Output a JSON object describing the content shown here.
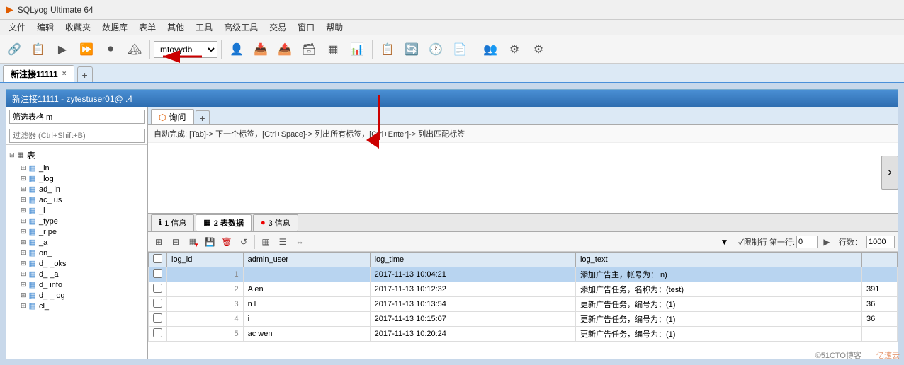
{
  "app": {
    "title": "SQLyog Ultimate 64",
    "icon": "▶"
  },
  "menu": {
    "items": [
      "文件",
      "编辑",
      "收藏夹",
      "数据库",
      "表单",
      "其他",
      "工具",
      "高级工具",
      "交易",
      "窗口",
      "帮助"
    ]
  },
  "toolbar": {
    "db_select": "mtoyydb",
    "db_options": [
      "mtoyydb"
    ]
  },
  "tabs": {
    "main_tab": "新注接11111",
    "close": "×",
    "add": "+"
  },
  "window": {
    "title": "新注接11111 - zytestuser01@          .4"
  },
  "left_panel": {
    "filter_table_placeholder": "筛选表格 m",
    "filter_input_placeholder": "过滤器 (Ctrl+Shift+B)",
    "tree_root": "表",
    "tree_items": [
      {
        "name": "   _in"
      },
      {
        "name": "   _log"
      },
      {
        "name": "ad_  in"
      },
      {
        "name": "ac_   us"
      },
      {
        "name": "   _l"
      },
      {
        "name": "   _type"
      },
      {
        "name": "   _r pe"
      },
      {
        "name": "   _a"
      },
      {
        "name": "   on_"
      },
      {
        "name": "d_   _oks"
      },
      {
        "name": "d_   _a"
      },
      {
        "name": "d_    info"
      },
      {
        "name": "d_  _   og"
      },
      {
        "name": "  cl_  "
      }
    ]
  },
  "right_panel": {
    "query_tab_label": "询问",
    "query_tab_add": "+",
    "autocomplete": "自动完成: [Tab]-> 下一个标签，[Ctrl+Space]-> 列出所有标签，[Ctrl+Enter]-> 列出匹配标签"
  },
  "result_tabs": {
    "tab1": {
      "icon": "ℹ",
      "label": "1 信息"
    },
    "tab2": {
      "icon": "▦",
      "label": "2 表数据",
      "active": true
    },
    "tab3": {
      "icon": "🔴",
      "label": "3 信息"
    }
  },
  "result_toolbar": {
    "filter_icon": "▼",
    "limit_row_label": "✓限制行 第一行:",
    "first_row_value": "0",
    "next_icon": "▶",
    "rows_label": "行数：",
    "rows_value": "1000"
  },
  "table": {
    "columns": [
      "",
      "log_id",
      "admin_user",
      "log_time",
      "log_text",
      ""
    ],
    "rows": [
      {
        "sel": false,
        "id": "1",
        "user": "",
        "time": "2017-11-13 10:04:21",
        "text": "添加广告主，帐号为：              n)",
        "extra": ""
      },
      {
        "sel": false,
        "id": "2",
        "user": "A    en",
        "time": "2017-11-13 10:12:32",
        "text": "添加广告任务，名称为：(test)",
        "extra": "391"
      },
      {
        "sel": false,
        "id": "3",
        "user": "   n  l",
        "time": "2017-11-13 10:13:54",
        "text": "更新广告任务，编号为：(1)",
        "extra": "36"
      },
      {
        "sel": false,
        "id": "4",
        "user": "   i  ",
        "time": "2017-11-13 10:15:07",
        "text": "更新广告任务，编号为：(1)",
        "extra": "36"
      },
      {
        "sel": false,
        "id": "5",
        "user": "ac  wen",
        "time": "2017-11-13 10:20:24",
        "text": "更新广告任务，编号为：(1)",
        "extra": ""
      }
    ]
  },
  "colors": {
    "header_bg": "#4a8fd4",
    "tab_active_bg": "#ffffff",
    "selected_row_bg": "#b8d4f0",
    "accent": "#2e6db0"
  },
  "watermark": "亿速云",
  "watermark2": "©51CTO博客"
}
